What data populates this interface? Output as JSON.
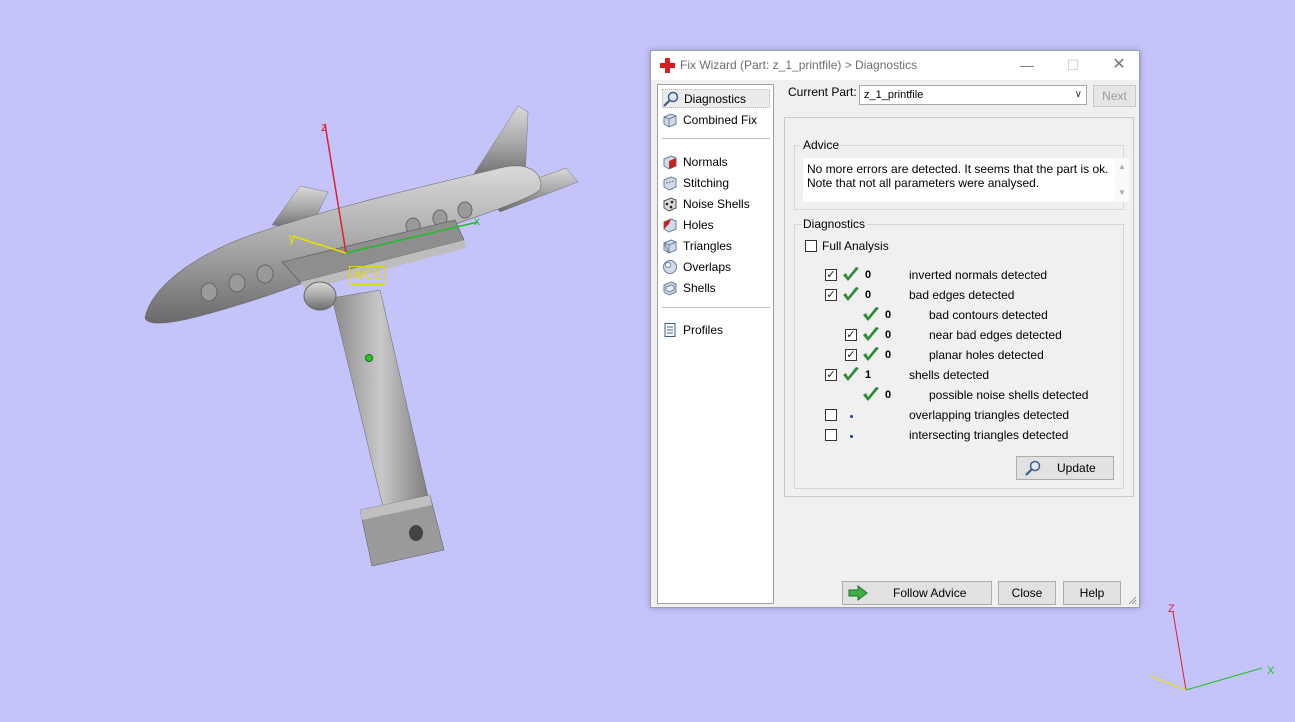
{
  "viewport": {
    "wcs_label": "WCS",
    "axes": {
      "z": "z",
      "y": "y",
      "x": "x"
    },
    "mini_axes": {
      "z": "Z",
      "x": "X"
    }
  },
  "dialog": {
    "title": "Fix Wizard (Part: z_1_printfile) > Diagnostics",
    "nav": {
      "top": [
        {
          "label": "Diagnostics",
          "icon": "magnifier-icon",
          "active": true
        },
        {
          "label": "Combined Fix",
          "icon": "cube-icon"
        }
      ],
      "middle": [
        {
          "label": "Normals",
          "icon": "normals-cube-icon"
        },
        {
          "label": "Stitching",
          "icon": "stitching-cube-icon"
        },
        {
          "label": "Noise Shells",
          "icon": "noise-shells-icon"
        },
        {
          "label": "Holes",
          "icon": "holes-cube-icon"
        },
        {
          "label": "Triangles",
          "icon": "triangles-icon"
        },
        {
          "label": "Overlaps",
          "icon": "overlaps-icon"
        },
        {
          "label": "Shells",
          "icon": "shells-icon"
        }
      ],
      "bottom": [
        {
          "label": "Profiles",
          "icon": "profiles-icon"
        }
      ]
    },
    "current_part_label": "Current Part:",
    "current_part_value": "z_1_printfile",
    "next_button": "Next",
    "advice": {
      "title": "Advice",
      "line1": "No more errors are detected. It seems that the part is ok.",
      "line2": "Note that not all parameters were analysed."
    },
    "diagnostics": {
      "title": "Diagnostics",
      "full_analysis_label": "Full Analysis",
      "full_analysis_checked": false,
      "rows": [
        {
          "checkbox": true,
          "checked": true,
          "status": "ok",
          "count": "0",
          "label": "inverted normals detected",
          "indent": 0
        },
        {
          "checkbox": true,
          "checked": true,
          "status": "ok",
          "count": "0",
          "label": "bad edges detected",
          "indent": 0
        },
        {
          "checkbox": false,
          "checked": false,
          "status": "ok",
          "count": "0",
          "label": "bad contours detected",
          "indent": 1
        },
        {
          "checkbox": true,
          "checked": true,
          "status": "ok",
          "count": "0",
          "label": "near bad edges detected",
          "indent": 1
        },
        {
          "checkbox": true,
          "checked": true,
          "status": "ok",
          "count": "0",
          "label": "planar holes detected",
          "indent": 1
        },
        {
          "checkbox": true,
          "checked": true,
          "status": "ok",
          "count": "1",
          "label": "shells detected",
          "indent": 0
        },
        {
          "checkbox": false,
          "checked": false,
          "status": "ok",
          "count": "0",
          "label": "possible noise shells detected",
          "indent": 1
        },
        {
          "checkbox": true,
          "checked": false,
          "status": "pending",
          "count": "",
          "label": "overlapping triangles detected",
          "indent": 0
        },
        {
          "checkbox": true,
          "checked": false,
          "status": "pending",
          "count": "",
          "label": "intersecting triangles detected",
          "indent": 0
        }
      ],
      "update_button": "Update"
    },
    "follow_advice_button": "Follow Advice",
    "close_button": "Close",
    "help_button": "Help"
  },
  "colors": {
    "viewport_bg": "#c4c4fb",
    "check_green": "#2e8b3a",
    "axis_z": "#e0202a",
    "axis_y": "#e8e000",
    "axis_x": "#19c020"
  }
}
